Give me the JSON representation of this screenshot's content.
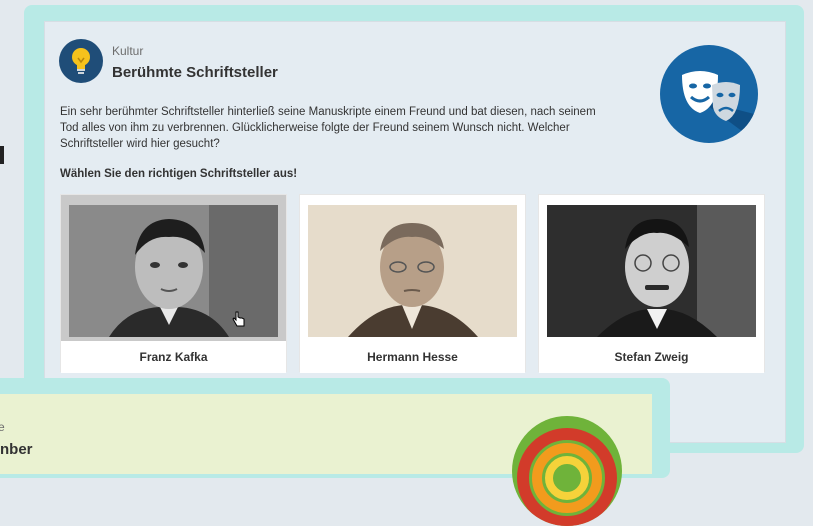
{
  "card": {
    "category": "Kultur",
    "title": "Berühmte Schriftsteller",
    "category_icon": "lightbulb-icon",
    "badge_icon": "theater-masks-icon",
    "question": "Ein sehr berühmter Schriftsteller hinterließ seine Manuskripte einem Freund und bat diesen, nach seinem Tod alles von ihm zu verbrennen. Glücklicherweise folgte der Freund seinem Wunsch nicht. Welcher Schriftsteller wird hier gesucht?",
    "instruction": "Wählen Sie den richtigen Schriftsteller aus!",
    "options": [
      {
        "label": "Franz Kafka"
      },
      {
        "label": "Hermann Hesse"
      },
      {
        "label": "Stefan Zweig"
      }
    ],
    "colors": {
      "outer": "#b8eae6",
      "inner": "#e4ecf2",
      "badge": "#1766a5",
      "icon": "#1f4d78"
    }
  },
  "card2": {
    "category": "e",
    "title": "nber",
    "badge_icon": "rings-icon",
    "colors": {
      "inner": "#eaf2d1",
      "badge": "#6fb33a"
    }
  }
}
